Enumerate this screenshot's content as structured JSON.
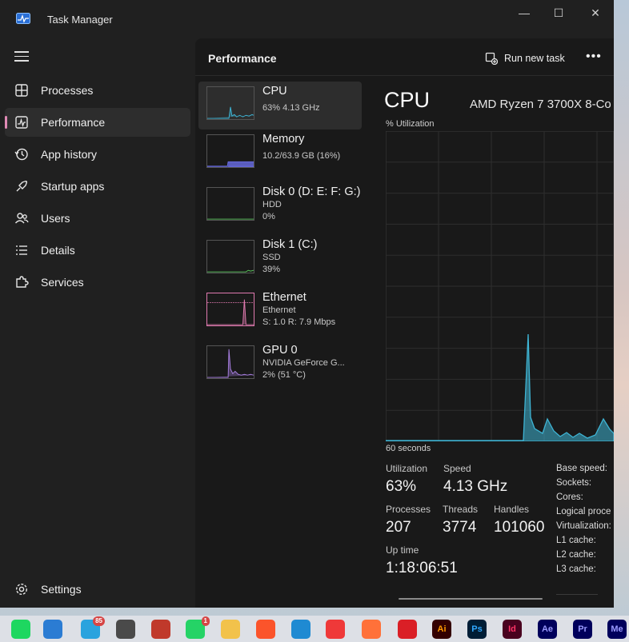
{
  "window": {
    "title": "Task Manager",
    "controls": {
      "minimize": "—",
      "maximize": "☐",
      "close": "✕"
    }
  },
  "sidebar": {
    "items": [
      {
        "label": "Processes",
        "icon": "grid-icon"
      },
      {
        "label": "Performance",
        "icon": "performance-icon",
        "active": true
      },
      {
        "label": "App history",
        "icon": "history-icon"
      },
      {
        "label": "Startup apps",
        "icon": "startup-icon"
      },
      {
        "label": "Users",
        "icon": "users-icon"
      },
      {
        "label": "Details",
        "icon": "details-icon"
      },
      {
        "label": "Services",
        "icon": "puzzle-icon"
      }
    ],
    "settings_label": "Settings"
  },
  "header": {
    "title": "Performance",
    "run_task_label": "Run new task",
    "more_label": "•••"
  },
  "perf_list": [
    {
      "name": "CPU",
      "sub1": "63%  4.13 GHz",
      "color": "#3eb4d4",
      "active": true
    },
    {
      "name": "Memory",
      "sub1": "10.2/63.9 GB (16%)",
      "color": "#6a6ee6"
    },
    {
      "name": "Disk 0 (D: E: F: G:)",
      "sub1": "HDD",
      "sub2": "0%",
      "color": "#58c45a"
    },
    {
      "name": "Disk 1 (C:)",
      "sub1": "SSD",
      "sub2": "39%",
      "color": "#58c45a"
    },
    {
      "name": "Ethernet",
      "sub1": "Ethernet",
      "sub2": "S: 1.0  R: 7.9 Mbps",
      "color": "#e07ab0"
    },
    {
      "name": "GPU 0",
      "sub1": "NVIDIA GeForce G...",
      "sub2": "2%  (51 °C)",
      "color": "#a77ee0"
    }
  ],
  "cpu": {
    "title": "CPU",
    "model": "AMD Ryzen 7 3700X 8-Co",
    "util_label": "% Utilization",
    "seconds_label": "60 seconds",
    "stats": {
      "utilization_label": "Utilization",
      "utilization": "63%",
      "speed_label": "Speed",
      "speed": "4.13 GHz",
      "processes_label": "Processes",
      "processes": "207",
      "threads_label": "Threads",
      "threads": "3774",
      "handles_label": "Handles",
      "handles": "101060",
      "uptime_label": "Up time",
      "uptime": "1:18:06:51"
    },
    "side_labels": [
      "Base speed:",
      "Sockets:",
      "Cores:",
      "Logical proce",
      "Virtualization:",
      "L1 cache:",
      "L2 cache:",
      "L3 cache:"
    ]
  },
  "taskbar": {
    "icons": [
      {
        "name": "spotify-icon",
        "text": "",
        "bg": "#1ed760"
      },
      {
        "name": "store-icon",
        "text": "",
        "bg": "#2b7cd3"
      },
      {
        "name": "telegram-icon",
        "text": "",
        "bg": "#2aa3de",
        "badge": "85"
      },
      {
        "name": "calculator-icon",
        "text": "",
        "bg": "#4a4a4a"
      },
      {
        "name": "snipping-icon",
        "text": "",
        "bg": "#c0392b"
      },
      {
        "name": "whatsapp-icon",
        "text": "",
        "bg": "#25d366",
        "badge": "1"
      },
      {
        "name": "file-explorer-icon",
        "text": "",
        "bg": "#f2c24b"
      },
      {
        "name": "brave-icon",
        "text": "",
        "bg": "#fb542b"
      },
      {
        "name": "edge-icon",
        "text": "",
        "bg": "#1f8ad2"
      },
      {
        "name": "vivaldi-icon",
        "text": "",
        "bg": "#ef3939"
      },
      {
        "name": "firefox-icon",
        "text": "",
        "bg": "#ff7139"
      },
      {
        "name": "creative-cloud-icon",
        "text": "",
        "bg": "#da1f26"
      },
      {
        "name": "illustrator-icon",
        "text": "Ai",
        "bg": "#330000",
        "fg": "#ff9a00"
      },
      {
        "name": "photoshop-icon",
        "text": "Ps",
        "bg": "#001e36",
        "fg": "#31a8ff"
      },
      {
        "name": "indesign-icon",
        "text": "Id",
        "bg": "#49021f",
        "fg": "#ff3366"
      },
      {
        "name": "after-effects-icon",
        "text": "Ae",
        "bg": "#00005b",
        "fg": "#9999ff"
      },
      {
        "name": "premiere-icon",
        "text": "Pr",
        "bg": "#00005b",
        "fg": "#9999ff"
      },
      {
        "name": "media-encoder-icon",
        "text": "Me",
        "bg": "#00005b",
        "fg": "#9999ff"
      }
    ]
  }
}
